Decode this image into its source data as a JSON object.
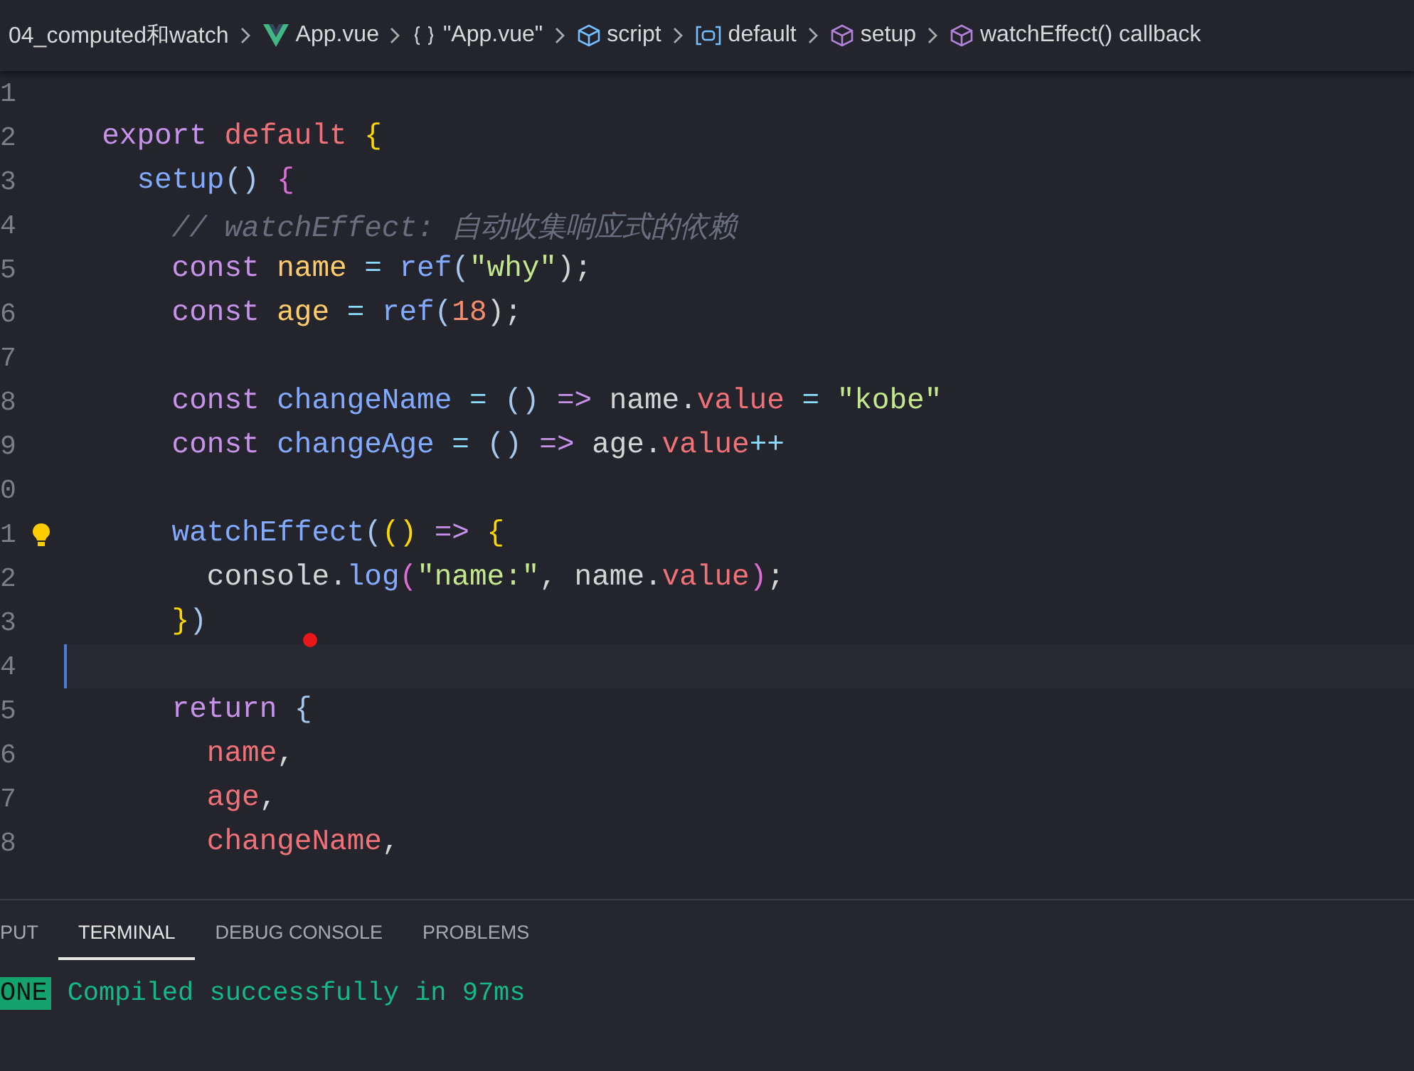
{
  "breadcrumb": [
    {
      "label": "04_computed和watch",
      "kind": "folder"
    },
    {
      "label": "App.vue",
      "kind": "file"
    },
    {
      "label": "\"App.vue\"",
      "kind": "object"
    },
    {
      "label": "script",
      "kind": "module"
    },
    {
      "label": "default",
      "kind": "variable"
    },
    {
      "label": "setup",
      "kind": "method"
    },
    {
      "label": "watchEffect() callback",
      "kind": "method"
    }
  ],
  "editor": {
    "lines": [
      {
        "number": "1",
        "lightbulb": false,
        "current": false
      },
      {
        "number": "2",
        "lightbulb": false,
        "current": false,
        "tokens": [
          {
            "t": "  export ",
            "kind": "keyword"
          },
          {
            "t": "default ",
            "kind": "def"
          },
          {
            "t": "{",
            "kind": "brace"
          }
        ]
      },
      {
        "number": "3",
        "lightbulb": false,
        "current": false,
        "tokens": [
          {
            "t": "    setup",
            "kind": "fn"
          },
          {
            "t": "() ",
            "kind": "punct"
          },
          {
            "t": "{",
            "kind": "brace2"
          }
        ]
      },
      {
        "number": "4",
        "lightbulb": false,
        "current": false,
        "tokens": [
          {
            "t": "      // watchEffect: 自动收集响应式的依赖",
            "kind": "comment"
          }
        ]
      },
      {
        "number": "5",
        "lightbulb": false,
        "current": false,
        "tokens": [
          {
            "t": "      const ",
            "kind": "keyword"
          },
          {
            "t": "name ",
            "kind": "var"
          },
          {
            "t": "= ",
            "kind": "op"
          },
          {
            "t": "ref",
            "kind": "fn"
          },
          {
            "t": "(",
            "kind": "punct"
          },
          {
            "t": "\"why\"",
            "kind": "str"
          },
          {
            "t": ");",
            "kind": "plain"
          }
        ]
      },
      {
        "number": "6",
        "lightbulb": false,
        "current": false,
        "tokens": [
          {
            "t": "      const ",
            "kind": "keyword"
          },
          {
            "t": "age ",
            "kind": "var"
          },
          {
            "t": "= ",
            "kind": "op"
          },
          {
            "t": "ref",
            "kind": "fn"
          },
          {
            "t": "(",
            "kind": "punct"
          },
          {
            "t": "18",
            "kind": "num"
          },
          {
            "t": ");",
            "kind": "plain"
          }
        ]
      },
      {
        "number": "7",
        "lightbulb": false,
        "current": false
      },
      {
        "number": "8",
        "lightbulb": false,
        "current": false,
        "tokens": [
          {
            "t": "      const ",
            "kind": "keyword"
          },
          {
            "t": "changeName ",
            "kind": "fn"
          },
          {
            "t": "= ",
            "kind": "op"
          },
          {
            "t": "() ",
            "kind": "punct"
          },
          {
            "t": "=> ",
            "kind": "keyword"
          },
          {
            "t": "name.",
            "kind": "plain"
          },
          {
            "t": "value ",
            "kind": "def"
          },
          {
            "t": "= ",
            "kind": "op"
          },
          {
            "t": "\"kobe\"",
            "kind": "str"
          }
        ]
      },
      {
        "number": "9",
        "lightbulb": false,
        "current": false,
        "tokens": [
          {
            "t": "      const ",
            "kind": "keyword"
          },
          {
            "t": "changeAge ",
            "kind": "fn"
          },
          {
            "t": "= ",
            "kind": "op"
          },
          {
            "t": "() ",
            "kind": "punct"
          },
          {
            "t": "=> ",
            "kind": "keyword"
          },
          {
            "t": "age.",
            "kind": "plain"
          },
          {
            "t": "value",
            "kind": "def"
          },
          {
            "t": "++",
            "kind": "op"
          }
        ]
      },
      {
        "number": "0",
        "lightbulb": false,
        "current": false
      },
      {
        "number": "1",
        "lightbulb": true,
        "current": false,
        "tokens": [
          {
            "t": "      watchEffect",
            "kind": "fn"
          },
          {
            "t": "(",
            "kind": "punct"
          },
          {
            "t": "() ",
            "kind": "brace"
          },
          {
            "t": "=> ",
            "kind": "keyword"
          },
          {
            "t": "{",
            "kind": "brace"
          }
        ]
      },
      {
        "number": "2",
        "lightbulb": false,
        "current": false,
        "tokens": [
          {
            "t": "        console.",
            "kind": "plain"
          },
          {
            "t": "log",
            "kind": "fn"
          },
          {
            "t": "(",
            "kind": "brace2"
          },
          {
            "t": "\"name:\"",
            "kind": "str"
          },
          {
            "t": ", name.",
            "kind": "plain"
          },
          {
            "t": "value",
            "kind": "def"
          },
          {
            "t": ")",
            "kind": "brace2"
          },
          {
            "t": ";",
            "kind": "plain"
          }
        ]
      },
      {
        "number": "3",
        "lightbulb": false,
        "current": false,
        "tokens": [
          {
            "t": "      }",
            "kind": "brace"
          },
          {
            "t": ")",
            "kind": "punct"
          }
        ]
      },
      {
        "number": "4",
        "lightbulb": false,
        "current": true
      },
      {
        "number": "5",
        "lightbulb": false,
        "current": false,
        "tokens": [
          {
            "t": "      return ",
            "kind": "keyword"
          },
          {
            "t": "{",
            "kind": "punct"
          }
        ]
      },
      {
        "number": "6",
        "lightbulb": false,
        "current": false,
        "tokens": [
          {
            "t": "        name",
            "kind": "def"
          },
          {
            "t": ",",
            "kind": "plain"
          }
        ]
      },
      {
        "number": "7",
        "lightbulb": false,
        "current": false,
        "tokens": [
          {
            "t": "        age",
            "kind": "def"
          },
          {
            "t": ",",
            "kind": "plain"
          }
        ]
      },
      {
        "number": "8",
        "lightbulb": false,
        "current": false,
        "tokens": [
          {
            "t": "        changeName",
            "kind": "def"
          },
          {
            "t": ",",
            "kind": "plain"
          }
        ]
      }
    ]
  },
  "panel": {
    "tabs": [
      {
        "label": "PUT",
        "selected": false
      },
      {
        "label": "TERMINAL",
        "selected": true
      },
      {
        "label": "DEBUG CONSOLE",
        "selected": false
      },
      {
        "label": "PROBLEMS",
        "selected": false
      }
    ],
    "terminal": {
      "badge": "ONE",
      "message": "Compiled successfully in 97ms"
    }
  }
}
